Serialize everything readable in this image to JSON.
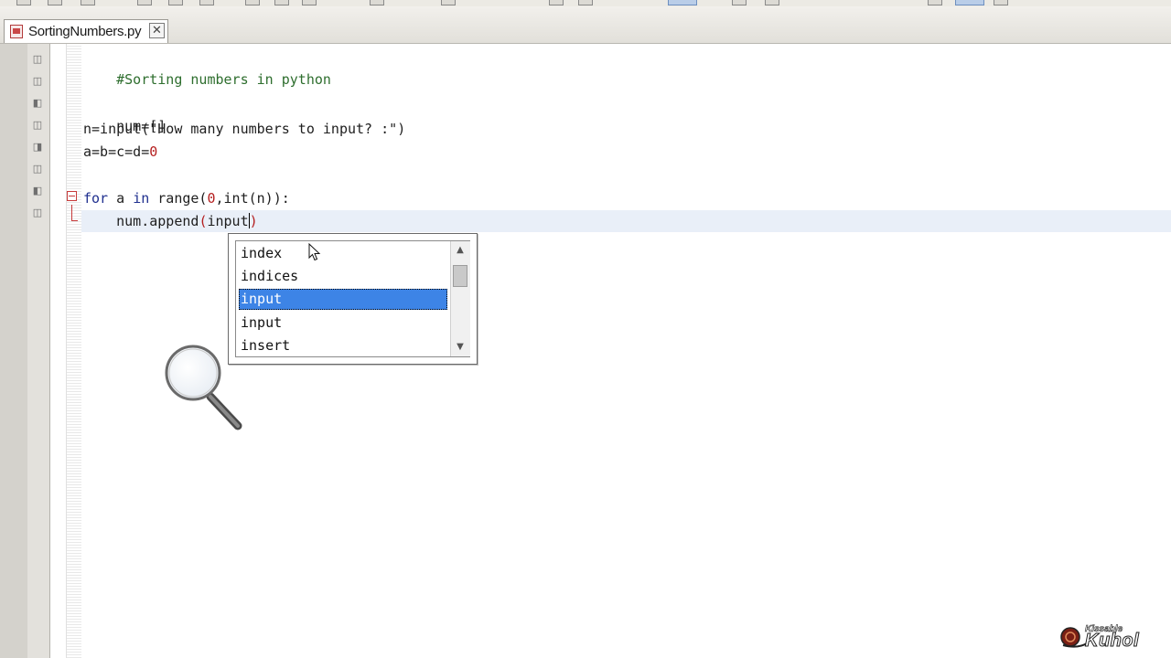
{
  "tab": {
    "title": "SortingNumbers.py",
    "close_symbol": "✕"
  },
  "editor": {
    "lines": [
      "#Sorting numbers in python",
      "",
      "num=[]",
      "n=input(\"How many numbers to input? :\")",
      "a=b=c=d=0",
      "",
      "for a in range(0,int(n)):",
      "    num.append(input)"
    ],
    "line1_comment": "#Sorting numbers in python",
    "line3": "num=[]",
    "line4_prefix": "n=input(",
    "line4_string": "\"How many numbers to input? :\"",
    "line4_suffix": ")",
    "line5_prefix": "a=b=c=d=",
    "line5_num": "0",
    "line7_kw1": "for",
    "line7_mid": " a ",
    "line7_kw2": "in",
    "line7_range": " range(",
    "line7_num": "0",
    "line7_rest": ",int(n)):",
    "line8_prefix": "    num.append",
    "line8_open": "(",
    "line8_arg": "input",
    "line8_close": ")"
  },
  "completion": {
    "items": [
      "index",
      "indices",
      "input",
      "input",
      "insert"
    ],
    "selected_index": 2
  },
  "watermark": {
    "small": "Kissable",
    "big": "Kuhol"
  },
  "colors": {
    "keyword": "#1f2f8f",
    "comment": "#2e6e2e",
    "number": "#b51f1f",
    "selection": "#3d84e6",
    "current_line": "#e9eff8"
  },
  "icons": [
    "python-file-icon",
    "close-icon",
    "fold-collapse-icon",
    "scroll-up-icon",
    "scroll-down-icon",
    "mouse-pointer-icon",
    "magnifier-icon"
  ]
}
